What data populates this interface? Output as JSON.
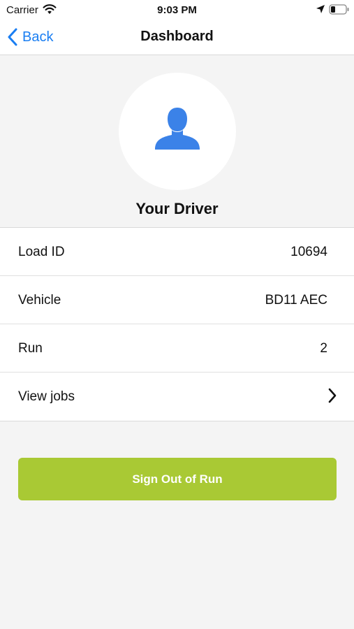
{
  "status_bar": {
    "carrier": "Carrier",
    "time": "9:03 PM",
    "icons": [
      "wifi-icon",
      "location-arrow-icon",
      "battery-icon"
    ]
  },
  "nav": {
    "back_label": "Back",
    "title": "Dashboard"
  },
  "profile": {
    "icon": "person-icon",
    "name": "Your Driver"
  },
  "details": {
    "rows": [
      {
        "label": "Load ID",
        "value": "10694"
      },
      {
        "label": "Vehicle",
        "value": "BD11 AEC"
      },
      {
        "label": "Run",
        "value": "2"
      },
      {
        "label": "View jobs",
        "value": "",
        "icon": "chevron-right-icon"
      }
    ]
  },
  "actions": {
    "sign_out_label": "Sign Out of Run"
  },
  "colors": {
    "accent_blue": "#1a7ef2",
    "avatar_blue": "#3b82e8",
    "button_green": "#a9c934",
    "background": "#f4f4f4"
  }
}
